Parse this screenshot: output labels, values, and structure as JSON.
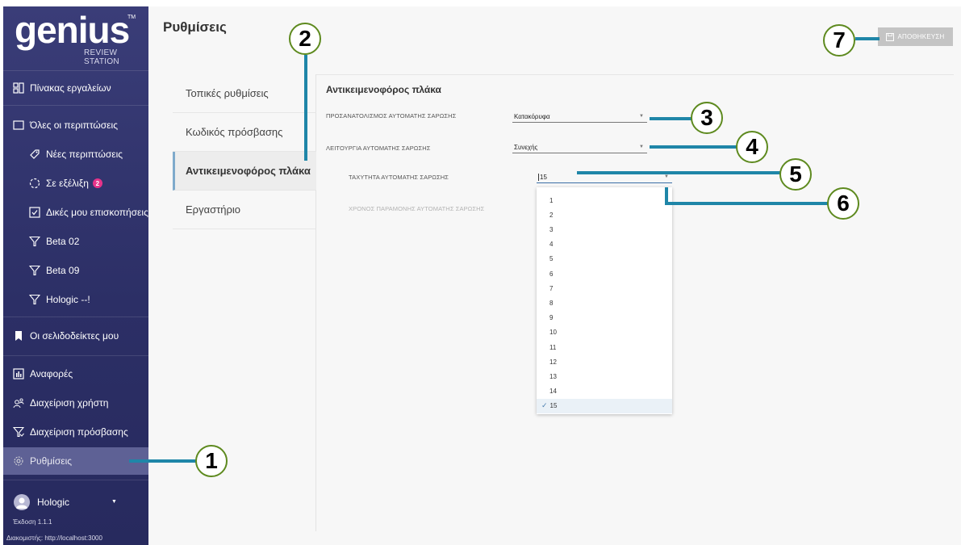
{
  "app": {
    "logo_word": "genius",
    "logo_tm": "TM",
    "logo_sub": "REVIEW STATION"
  },
  "sidebar": {
    "items": [
      {
        "label": "Πίνακας εργαλείων",
        "icon": "dashboard-icon"
      },
      {
        "label": "Όλες οι περιπτώσεις",
        "icon": "folder-icon"
      },
      {
        "label": "Νέες περιπτώσεις",
        "icon": "tag-icon"
      },
      {
        "label": "Σε εξέλιξη",
        "icon": "progress-icon",
        "badge": "2"
      },
      {
        "label": "Δικές μου επισκοπήσεις",
        "icon": "checkbox-icon"
      },
      {
        "label": "Beta 02",
        "icon": "filter-icon"
      },
      {
        "label": "Beta 09",
        "icon": "filter-icon"
      },
      {
        "label": "Hologic --!",
        "icon": "filter-icon"
      },
      {
        "label": "Οι σελιδοδείκτες μου",
        "icon": "bookmark-icon"
      },
      {
        "label": "Αναφορές",
        "icon": "reports-icon"
      },
      {
        "label": "Διαχείριση χρήστη",
        "icon": "users-icon"
      },
      {
        "label": "Διαχείριση πρόσβασης",
        "icon": "access-filter-icon"
      },
      {
        "label": "Ρυθμίσεις",
        "icon": "gear-icon"
      }
    ],
    "user": {
      "name": "Hologic",
      "version": "Έκδοση 1.1.1",
      "server": "Διακομιστής: http://localhost:3000"
    }
  },
  "main": {
    "title": "Ρυθμίσεις",
    "save_label": "ΑΠΟΘΗΚΕΥΣΗ",
    "submenu": [
      {
        "label": "Τοπικές ρυθμίσεις"
      },
      {
        "label": "Κωδικός πρόσβασης"
      },
      {
        "label": "Αντικειμενοφόρος πλάκα"
      },
      {
        "label": "Εργαστήριο"
      }
    ],
    "section_title": "Αντικειμενοφόρος πλάκα",
    "fields": [
      {
        "label": "ΠΡΟΣΑΝΑΤΟΛΙΣΜΟΣ ΑΥΤΟΜΑΤΗΣ ΣΑΡΩΣΗΣ",
        "value": "Κατακόρυφα"
      },
      {
        "label": "ΛΕΙΤΟΥΡΓΙΑ ΑΥΤΟΜΑΤΗΣ ΣΑΡΩΣΗΣ",
        "value": "Συνεχής"
      },
      {
        "label": "ΤΑΧΥΤΗΤΑ ΑΥΤΟΜΑΤΗΣ ΣΑΡΩΣΗΣ",
        "value": "15"
      },
      {
        "label": "ΧΡΟΝΟΣ ΠΑΡΑΜΟΝΗΣ ΑΥΤΟΜΑΤΗΣ ΣΑΡΩΣΗΣ",
        "value": ""
      }
    ],
    "speed_options": [
      "1",
      "2",
      "3",
      "4",
      "5",
      "6",
      "7",
      "8",
      "9",
      "10",
      "11",
      "12",
      "13",
      "14",
      "15"
    ],
    "speed_selected": "15"
  },
  "callouts": [
    "1",
    "2",
    "3",
    "4",
    "5",
    "6",
    "7"
  ],
  "colors": {
    "sidebar": "#2f3270",
    "active_nav": "#5e6195",
    "badge": "#e8338a",
    "callout_border": "#5e8a1f",
    "leader": "#1f86a8",
    "save_disabled": "#c4c4c4"
  }
}
